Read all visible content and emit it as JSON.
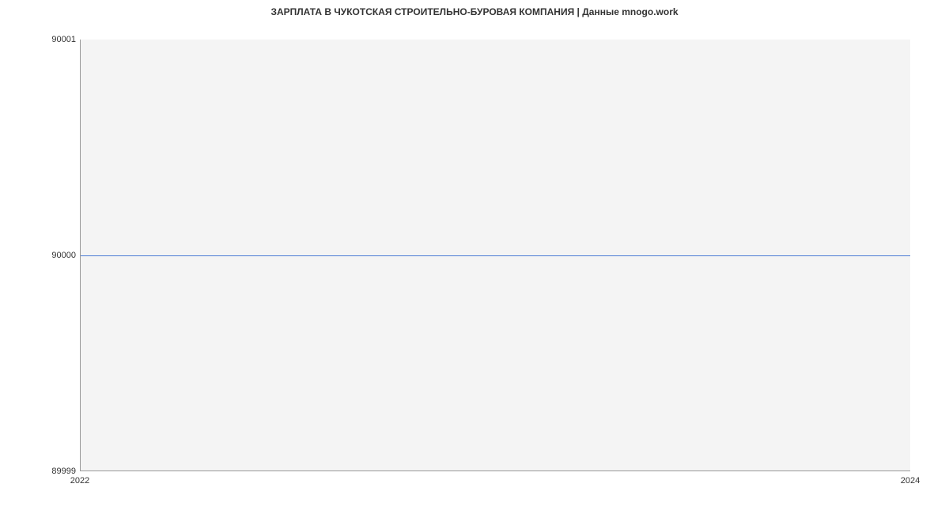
{
  "chart_data": {
    "type": "line",
    "title": "ЗАРПЛАТА В  ЧУКОТСКАЯ СТРОИТЕЛЬНО-БУРОВАЯ КОМПАНИЯ | Данные mnogo.work",
    "x": [
      2022,
      2024
    ],
    "values": [
      90000,
      90000
    ],
    "x_ticks": [
      "2022",
      "2024"
    ],
    "y_ticks": [
      "89999",
      "90000",
      "90001"
    ],
    "xlim": [
      2022,
      2024
    ],
    "ylim": [
      89999,
      90001
    ],
    "xlabel": "",
    "ylabel": ""
  }
}
